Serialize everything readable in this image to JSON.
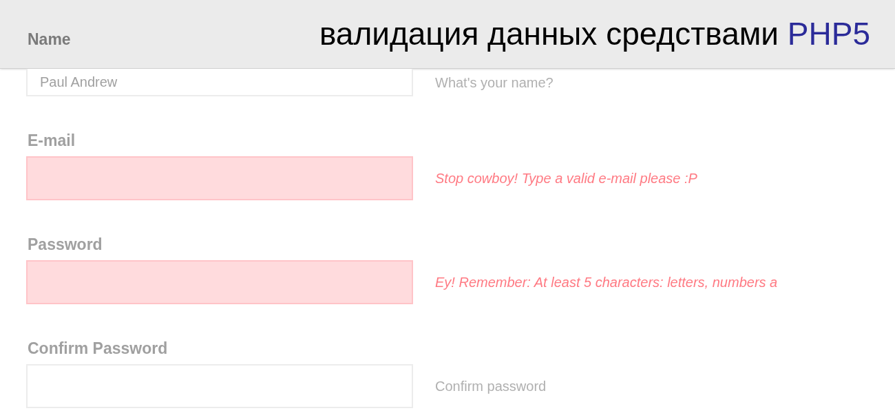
{
  "banner": {
    "title": "валидация данных средствами",
    "highlight": "PHP5"
  },
  "fields": [
    {
      "label": "Name",
      "value": "Paul Andrew",
      "hint": "What's your name?",
      "invalid": false
    },
    {
      "label": "E-mail",
      "hint": "Stop cowboy! Type a valid e-mail please :P",
      "invalid": true
    },
    {
      "label": "Password",
      "hint": "Ey! Remember: At least 5 characters: letters, numbers a",
      "invalid": true
    },
    {
      "label": "Confirm Password",
      "hint": "Confirm password",
      "invalid": false
    }
  ]
}
